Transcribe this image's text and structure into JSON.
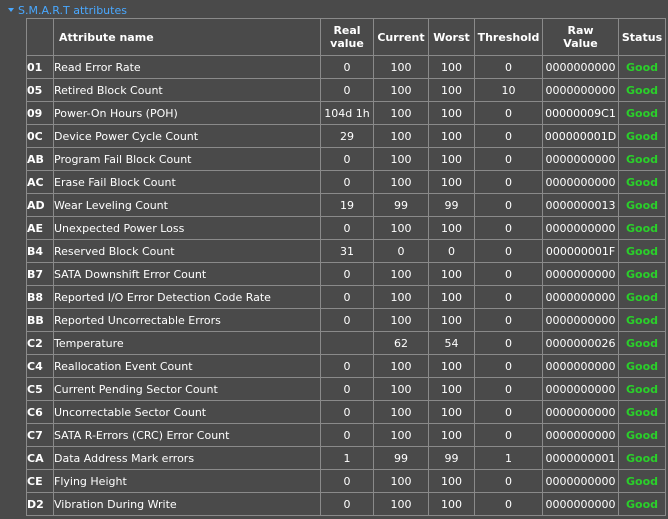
{
  "section": {
    "title": "S.M.A.R.T attributes"
  },
  "columns": {
    "name": "Attribute name",
    "real_line1": "Real",
    "real_line2": "value",
    "current": "Current",
    "worst": "Worst",
    "threshold": "Threshold",
    "raw_line1": "Raw",
    "raw_line2": "Value",
    "status": "Status"
  },
  "rows": [
    {
      "id": "01",
      "name": "Read Error Rate",
      "real": "0",
      "current": "100",
      "worst": "100",
      "threshold": "0",
      "raw": "0000000000",
      "status": "Good"
    },
    {
      "id": "05",
      "name": "Retired Block Count",
      "real": "0",
      "current": "100",
      "worst": "100",
      "threshold": "10",
      "raw": "0000000000",
      "status": "Good"
    },
    {
      "id": "09",
      "name": "Power-On Hours (POH)",
      "real": "104d 1h",
      "current": "100",
      "worst": "100",
      "threshold": "0",
      "raw": "00000009C1",
      "status": "Good"
    },
    {
      "id": "0C",
      "name": "Device Power Cycle Count",
      "real": "29",
      "current": "100",
      "worst": "100",
      "threshold": "0",
      "raw": "000000001D",
      "status": "Good"
    },
    {
      "id": "AB",
      "name": "Program Fail Block Count",
      "real": "0",
      "current": "100",
      "worst": "100",
      "threshold": "0",
      "raw": "0000000000",
      "status": "Good"
    },
    {
      "id": "AC",
      "name": "Erase Fail Block Count",
      "real": "0",
      "current": "100",
      "worst": "100",
      "threshold": "0",
      "raw": "0000000000",
      "status": "Good"
    },
    {
      "id": "AD",
      "name": "Wear Leveling Count",
      "real": "19",
      "current": "99",
      "worst": "99",
      "threshold": "0",
      "raw": "0000000013",
      "status": "Good"
    },
    {
      "id": "AE",
      "name": "Unexpected Power Loss",
      "real": "0",
      "current": "100",
      "worst": "100",
      "threshold": "0",
      "raw": "0000000000",
      "status": "Good"
    },
    {
      "id": "B4",
      "name": "Reserved Block Count",
      "real": "31",
      "current": "0",
      "worst": "0",
      "threshold": "0",
      "raw": "000000001F",
      "status": "Good"
    },
    {
      "id": "B7",
      "name": "SATA Downshift Error Count",
      "real": "0",
      "current": "100",
      "worst": "100",
      "threshold": "0",
      "raw": "0000000000",
      "status": "Good"
    },
    {
      "id": "B8",
      "name": "Reported I/O Error Detection Code Rate",
      "real": "0",
      "current": "100",
      "worst": "100",
      "threshold": "0",
      "raw": "0000000000",
      "status": "Good"
    },
    {
      "id": "BB",
      "name": "Reported Uncorrectable Errors",
      "real": "0",
      "current": "100",
      "worst": "100",
      "threshold": "0",
      "raw": "0000000000",
      "status": "Good"
    },
    {
      "id": "C2",
      "name": "Temperature",
      "real": "",
      "current": "62",
      "worst": "54",
      "threshold": "0",
      "raw": "0000000026",
      "status": "Good"
    },
    {
      "id": "C4",
      "name": "Reallocation Event Count",
      "real": "0",
      "current": "100",
      "worst": "100",
      "threshold": "0",
      "raw": "0000000000",
      "status": "Good"
    },
    {
      "id": "C5",
      "name": "Current Pending Sector Count",
      "real": "0",
      "current": "100",
      "worst": "100",
      "threshold": "0",
      "raw": "0000000000",
      "status": "Good"
    },
    {
      "id": "C6",
      "name": "Uncorrectable Sector Count",
      "real": "0",
      "current": "100",
      "worst": "100",
      "threshold": "0",
      "raw": "0000000000",
      "status": "Good"
    },
    {
      "id": "C7",
      "name": "SATA R-Errors (CRC) Error Count",
      "real": "0",
      "current": "100",
      "worst": "100",
      "threshold": "0",
      "raw": "0000000000",
      "status": "Good"
    },
    {
      "id": "CA",
      "name": "Data Address Mark errors",
      "real": "1",
      "current": "99",
      "worst": "99",
      "threshold": "1",
      "raw": "0000000001",
      "status": "Good"
    },
    {
      "id": "CE",
      "name": "Flying Height",
      "real": "0",
      "current": "100",
      "worst": "100",
      "threshold": "0",
      "raw": "0000000000",
      "status": "Good"
    },
    {
      "id": "D2",
      "name": "Vibration During Write",
      "real": "0",
      "current": "100",
      "worst": "100",
      "threshold": "0",
      "raw": "0000000000",
      "status": "Good"
    }
  ]
}
